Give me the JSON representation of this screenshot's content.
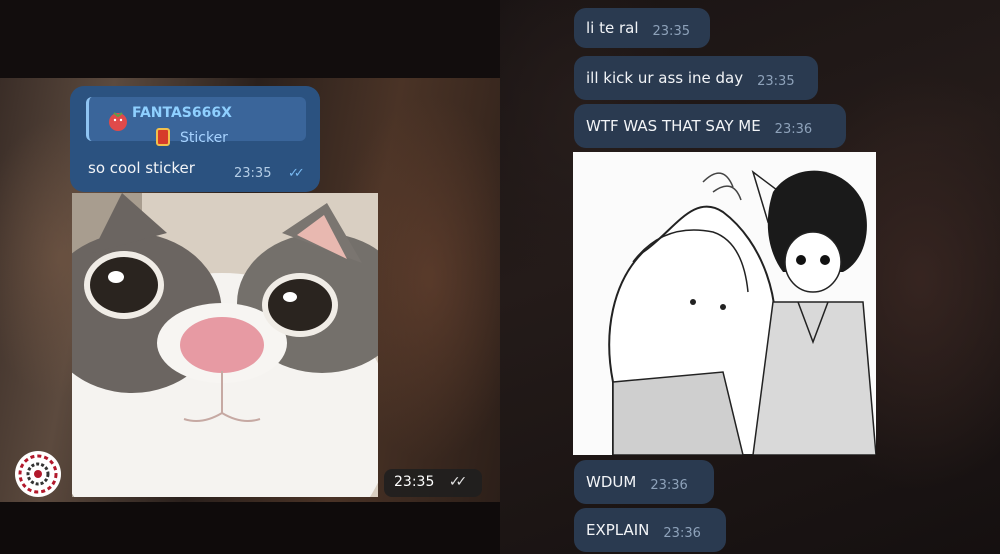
{
  "left_chat": {
    "reply_author": "FANTAS666X",
    "reply_subtitle": "Sticker",
    "message_text": "so cool sticker",
    "message_time": "23:35",
    "read_receipt": "✓✓",
    "photo_time": "23:35",
    "photo_receipt": "✓✓"
  },
  "right_chat": {
    "messages": [
      {
        "text": "li te ral",
        "time": "23:35"
      },
      {
        "text": "ill kick ur ass ine day",
        "time": "23:35"
      },
      {
        "text": "WTF WAS THAT SAY ME",
        "time": "23:36"
      },
      {
        "text": "WDUM",
        "time": "23:36"
      },
      {
        "text": "EXPLAIN",
        "time": "23:36"
      }
    ]
  },
  "colors": {
    "bubble_dark": "#2a3a50",
    "bubble_blue": "#2b5280",
    "accent": "#8fd0ff"
  },
  "icons": {
    "read_receipt": "double-check-icon",
    "sticker": "strawberry-sticker-icon",
    "can": "tomato-can-icon",
    "avatar": "mandala-avatar-icon"
  }
}
